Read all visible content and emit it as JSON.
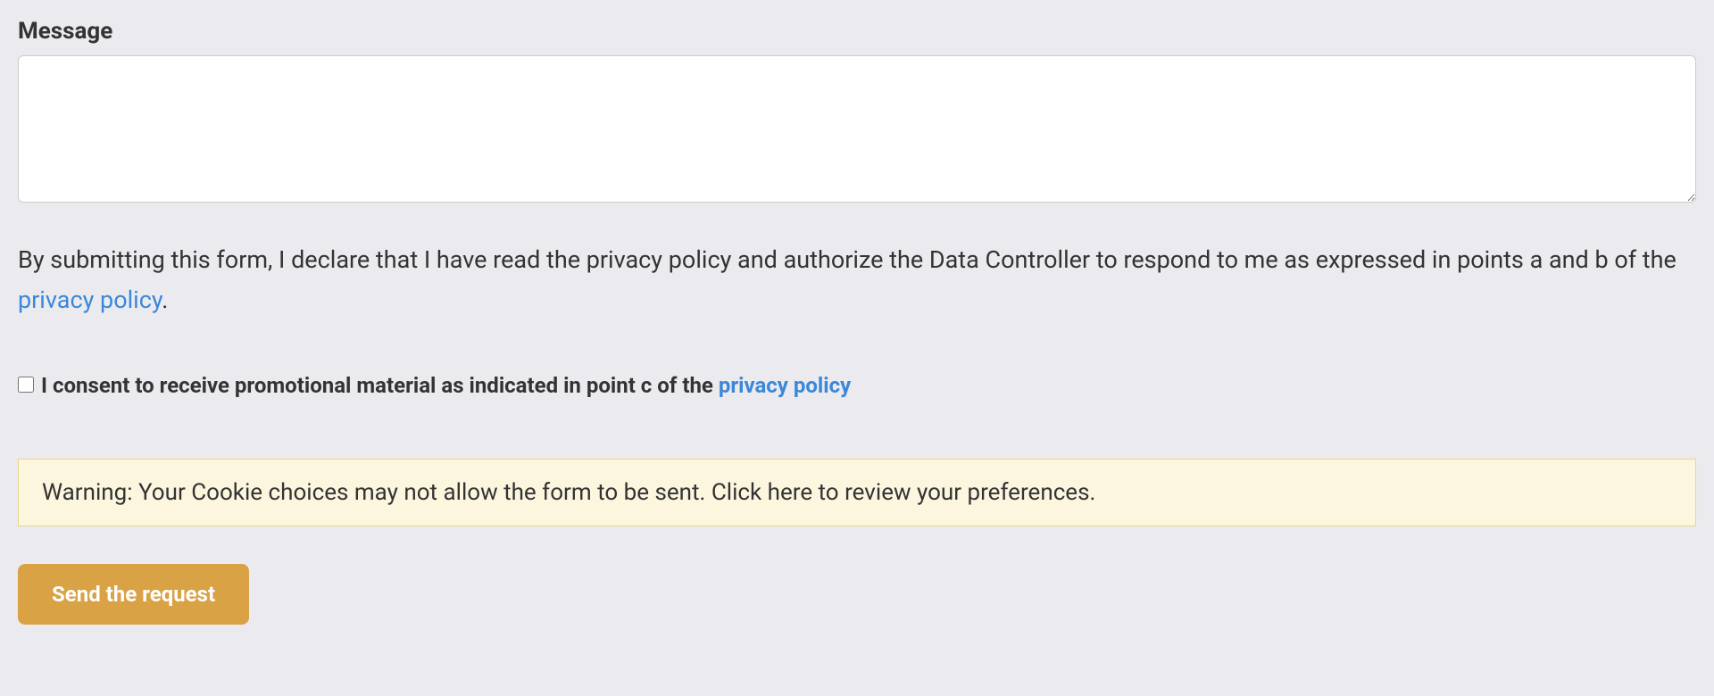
{
  "form": {
    "message_label": "Message",
    "message_value": "",
    "declaration_text_before": "By submitting this form, I declare that I have read the privacy policy and authorize the Data Controller to respond to me as expressed in points a and b of the ",
    "declaration_link_text": "privacy policy",
    "declaration_text_after": ".",
    "consent_text_before": "I consent to receive promotional material as indicated in point c of the ",
    "consent_link_text": "privacy policy",
    "warning_text": "Warning: Your Cookie choices may not allow the form to be sent. Click here to review your preferences.",
    "submit_label": "Send the request"
  }
}
